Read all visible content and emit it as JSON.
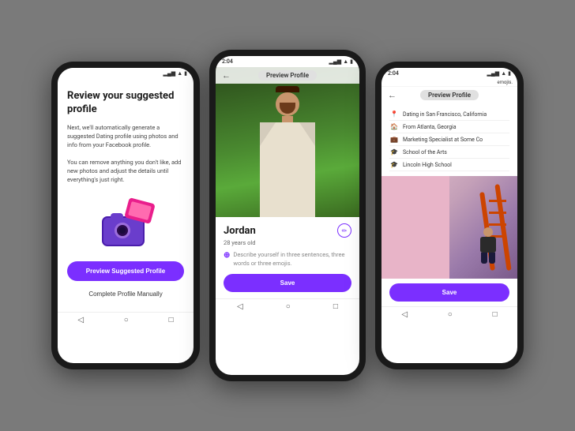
{
  "phone1": {
    "title": "Review your suggested profile",
    "description1": "Next, we'll automatically generate a suggested Dating profile using photos and info from your Facebook profile.",
    "description2": "You can remove anything you don't like, add new photos and adjust the details until everything's just right.",
    "btn_preview": "Preview Suggested Profile",
    "btn_complete": "Complete Profile Manually"
  },
  "phone2": {
    "header_title": "Preview Profile",
    "back_label": "←",
    "profile_name": "Jordan",
    "profile_age": "28 years old",
    "bio_placeholder": "Describe yourself in three sentences, three words or three emojis.",
    "btn_save": "Save",
    "time": "2:04"
  },
  "phone3": {
    "header_title": "Preview Profile",
    "back_label": "←",
    "time": "2:04",
    "top_label": "emojis.",
    "detail_location": "Dating in San Francisco, California",
    "detail_from": "From Atlanta, Georgia",
    "detail_job": "Marketing Specialist at Some Co",
    "detail_school1": "School of the Arts",
    "detail_school2": "Lincoln High School",
    "btn_save": "Save"
  },
  "icons": {
    "location": "📍",
    "home": "🏠",
    "work": "💼",
    "school": "🎓",
    "back": "←",
    "edit": "✏"
  }
}
